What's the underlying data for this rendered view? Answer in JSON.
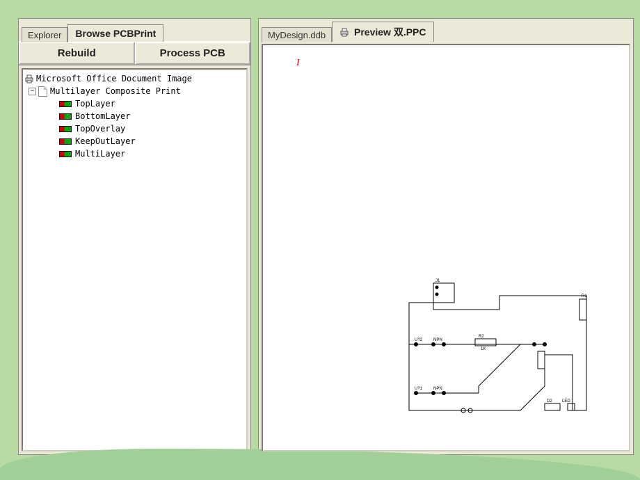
{
  "leftPanel": {
    "tabs": [
      {
        "label": "Explorer",
        "active": false
      },
      {
        "label": "Browse PCBPrint",
        "active": true
      }
    ],
    "buttons": {
      "rebuild": "Rebuild",
      "processPCB": "Process PCB"
    },
    "tree": {
      "root": "Microsoft Office Document Image",
      "composite": "Multilayer Composite Print",
      "layers": [
        "TopLayer",
        "BottomLayer",
        "TopOverlay",
        "KeepOutLayer",
        "MultiLayer"
      ]
    }
  },
  "rightPanel": {
    "tabs": [
      {
        "label": "MyDesign.ddb",
        "active": false
      },
      {
        "label": "Preview 双.PPC",
        "active": true,
        "hasIcon": true
      }
    ],
    "caret": "I"
  }
}
